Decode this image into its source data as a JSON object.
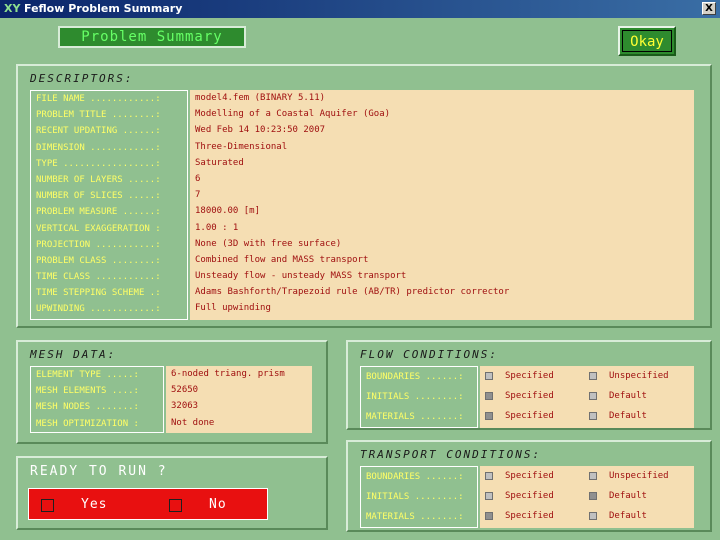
{
  "window": {
    "title": "Feflow Problem Summary",
    "close_label": "X",
    "app_icon": "feflow-logo-icon",
    "icon_glyph": "XY"
  },
  "header": {
    "title": "Problem Summary",
    "okay_label": "Okay"
  },
  "descriptors": {
    "title": "DESCRIPTORS:",
    "rows": [
      {
        "label": "FILE NAME ............:",
        "value": "model4.fem  (BINARY 5.11)"
      },
      {
        "label": "PROBLEM TITLE ........:",
        "value": "Modelling of a Coastal Aquifer (Goa)"
      },
      {
        "label": "RECENT UPDATING ......:",
        "value": "Wed Feb 14 10:23:50 2007"
      },
      {
        "label": "DIMENSION ............:",
        "value": "Three-Dimensional"
      },
      {
        "label": "TYPE .................:",
        "value": "Saturated"
      },
      {
        "label": "NUMBER OF LAYERS .....:",
        "value": "6"
      },
      {
        "label": "NUMBER OF SLICES .....:",
        "value": "7"
      },
      {
        "label": "PROBLEM MEASURE ......:",
        "value": "18000.00  [m]"
      },
      {
        "label": "VERTICAL EXAGGERATION :",
        "value": "1.00 : 1"
      },
      {
        "label": "PROJECTION ...........:",
        "value": "None (3D with free surface)"
      },
      {
        "label": "PROBLEM CLASS ........:",
        "value": "Combined flow and MASS transport"
      },
      {
        "label": "TIME CLASS ...........:",
        "value": "Unsteady flow - unsteady MASS transport"
      },
      {
        "label": "TIME STEPPING SCHEME .:",
        "value": "Adams Bashforth/Trapezoid rule (AB/TR) predictor corrector"
      },
      {
        "label": "UPWINDING ............:",
        "value": "Full upwinding"
      }
    ]
  },
  "mesh": {
    "title": "MESH DATA:",
    "rows": [
      {
        "label": "ELEMENT TYPE .....:",
        "value": "6-noded triang. prism"
      },
      {
        "label": "MESH ELEMENTS ....:",
        "value": "52650"
      },
      {
        "label": "MESH NODES .......:",
        "value": "32063"
      },
      {
        "label": "MESH OPTIMIZATION :",
        "value": "Not done"
      }
    ]
  },
  "ready": {
    "title": "READY TO RUN ?",
    "yes_label": "Yes",
    "no_label": "No"
  },
  "flow": {
    "title": "FLOW CONDITIONS:",
    "rows": [
      {
        "label": "BOUNDARIES ......:",
        "specified": "Specified",
        "other": "Unspecified",
        "specified_checked": false,
        "other_checked": false
      },
      {
        "label": "INITIALS ........:",
        "specified": "Specified",
        "other": "Default",
        "specified_checked": true,
        "other_checked": false
      },
      {
        "label": "MATERIALS .......:",
        "specified": "Specified",
        "other": "Default",
        "specified_checked": true,
        "other_checked": false
      }
    ]
  },
  "transport": {
    "title": "TRANSPORT CONDITIONS:",
    "rows": [
      {
        "label": "BOUNDARIES ......:",
        "specified": "Specified",
        "other": "Unspecified",
        "specified_checked": false,
        "other_checked": false
      },
      {
        "label": "INITIALS ........:",
        "specified": "Specified",
        "other": "Default",
        "specified_checked": false,
        "other_checked": true
      },
      {
        "label": "MATERIALS .......:",
        "specified": "Specified",
        "other": "Default",
        "specified_checked": true,
        "other_checked": false
      }
    ]
  }
}
